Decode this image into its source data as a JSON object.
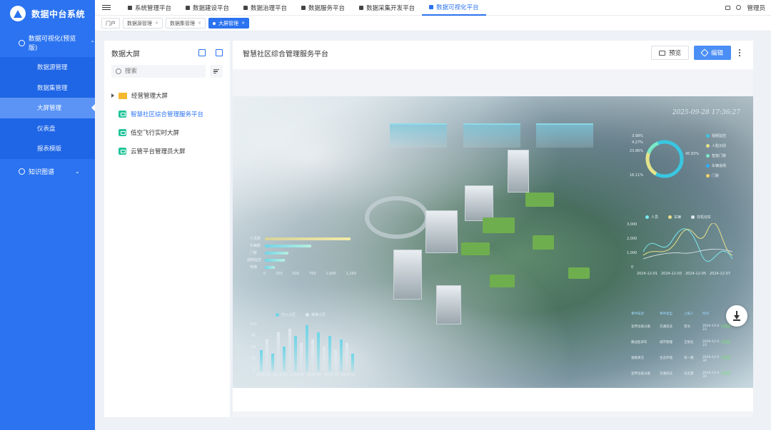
{
  "app": {
    "title": "数据中台系统"
  },
  "sidebar": {
    "group_label": "数据可视化(预览版)",
    "items": [
      {
        "label": "数据源管理"
      },
      {
        "label": "数据集管理"
      },
      {
        "label": "大屏管理"
      },
      {
        "label": "仪表盘"
      },
      {
        "label": "报表模版"
      }
    ],
    "kb_label": "知识图谱"
  },
  "topnav": {
    "tabs": [
      {
        "label": "系统管理平台"
      },
      {
        "label": "数据建设平台"
      },
      {
        "label": "数据治理平台"
      },
      {
        "label": "数据服务平台"
      },
      {
        "label": "数据采集开发平台"
      },
      {
        "label": "数据可视化平台"
      }
    ],
    "user": "管理员"
  },
  "crumbs": [
    {
      "label": "门户"
    },
    {
      "label": "数据源管理"
    },
    {
      "label": "数据集管理"
    },
    {
      "label": "大屏管理"
    }
  ],
  "panel": {
    "title": "数据大屏",
    "search_placeholder": "搜索",
    "folder": "经营管理大屏",
    "screens": [
      {
        "label": "智慧社区综合管理服务平台"
      },
      {
        "label": "低空飞行实时大屏"
      },
      {
        "label": "云管平台管理员大屏"
      }
    ]
  },
  "main": {
    "title": "智慧社区综合管理服务平台",
    "preview_label": "预览",
    "edit_label": "编辑"
  },
  "dashboard": {
    "timestamp": "2025-09-28 17:36:27",
    "donut_pcts": [
      "3.98%",
      "4.27%",
      "23.86%",
      "45.83%",
      "16.11%"
    ],
    "donut_legend": [
      "视频监控",
      "人脸识别",
      "智能门禁",
      "车辆道闸",
      "门禁"
    ],
    "line_legend": [
      "人员",
      "车辆",
      "非机动车"
    ],
    "line_yticks": [
      "3,000",
      "2,000",
      "1,000",
      "0"
    ],
    "line_xticks": [
      "2024-12-01",
      "2024-12-03",
      "2024-12-05",
      "2024-12-07"
    ],
    "hbar_labels": [
      "人员数",
      "车辆数",
      "门禁",
      "视频监控",
      "电梯"
    ],
    "hbar_xticks": [
      "0",
      "250",
      "500",
      "750",
      "1,000",
      "1,250"
    ],
    "vbar_legend": [
      "已入小区",
      "离离小区"
    ],
    "vbar_yticks": [
      "120",
      "90",
      "60",
      "30",
      "0"
    ],
    "vbar_xticks": [
      "2024-01",
      "2024-03",
      "2024-05",
      "2024-07",
      "2024-09",
      "2024-11"
    ],
    "table_headers": [
      "事件描述",
      "事件类型",
      "上报人",
      "时间"
    ],
    "table_rows": [
      [
        "宣传垃圾分类",
        "交通违法",
        "李文",
        "2024-12-4 23"
      ],
      [
        "路边乱停车",
        "城市管理",
        "王悦北",
        "2024-12-4 23"
      ],
      [
        "道路清洁",
        "生态环境",
        "李一楼",
        "2024-12-4 30"
      ],
      [
        "宣传垃圾分类",
        "交通违法",
        "肖志慧",
        "2024-12-4 30"
      ]
    ],
    "table_status": [
      "已完成",
      "已完成",
      "已完成",
      "已完成"
    ]
  },
  "colors": {
    "accent": "#2b73f0",
    "sidebar": "#2b73f0",
    "folder": "#f5b82e",
    "screen_icon": "#22c59a"
  }
}
